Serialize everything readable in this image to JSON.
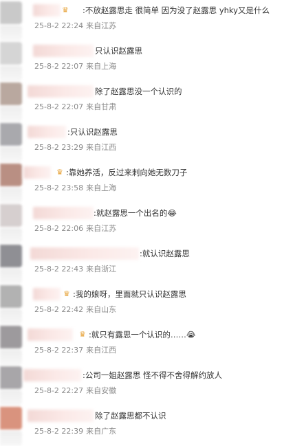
{
  "comments": [
    {
      "text": ":不放赵露思走 很简单  因为没了赵露思 yhky又是什么",
      "date": "25-8-2 22:24",
      "location": "来自江苏",
      "crown": "crown-icon",
      "avatar_color": "#c9c9c9"
    },
    {
      "text": "只认识赵露思",
      "date": "25-8-2 22:07",
      "location": "来自上海",
      "crown": "",
      "avatar_color": "#d5d5d5"
    },
    {
      "text": "除了赵露思没一个认识的",
      "date": "25-8-2 22:07",
      "location": "来自甘肃",
      "crown": "",
      "avatar_color": "#b9a89f"
    },
    {
      "text": ":只认识赵露思",
      "date": "25-8-2 23:29",
      "location": "来自江西",
      "crown": "",
      "avatar_color": "#a9a9ad"
    },
    {
      "text": ":靠她养活，反过来刺向她无数刀子",
      "date": "25-8-2 23:58",
      "location": "来自上海",
      "crown": "crown-icon",
      "avatar_color": "#b98f83"
    },
    {
      "text": ":就赵露思一个出名的😂",
      "date": "25-8-2 22:06",
      "location": "来自江苏",
      "crown": "",
      "avatar_color": "#d6cfcf"
    },
    {
      "text": ":就认识赵露思",
      "date": "25-8-2 22:43",
      "location": "来自浙江",
      "crown": "",
      "avatar_color": "#8f8f94"
    },
    {
      "text": ":我的娘呀，里面就只认识赵露思",
      "date": "25-8-2 22:42",
      "location": "来自山东",
      "crown": "crown-icon",
      "avatar_color": "#b2b2b2"
    },
    {
      "text": ":就只有露思一个认识的……😭",
      "date": "25-8-2 22:37",
      "location": "来自江西",
      "crown": "crown-icon",
      "avatar_color": "#9d9a9d"
    },
    {
      "text": ":公司一姐赵露思 怪不得不舍得解约放人",
      "date": "25-8-2 22:27",
      "location": "来自安徽",
      "crown": "",
      "avatar_color": "#a8a6a9"
    },
    {
      "text": "除了赵露思都不认识",
      "date": "25-8-2 22:39",
      "location": "来自广东",
      "crown": "",
      "avatar_color": "#d9937e"
    }
  ]
}
